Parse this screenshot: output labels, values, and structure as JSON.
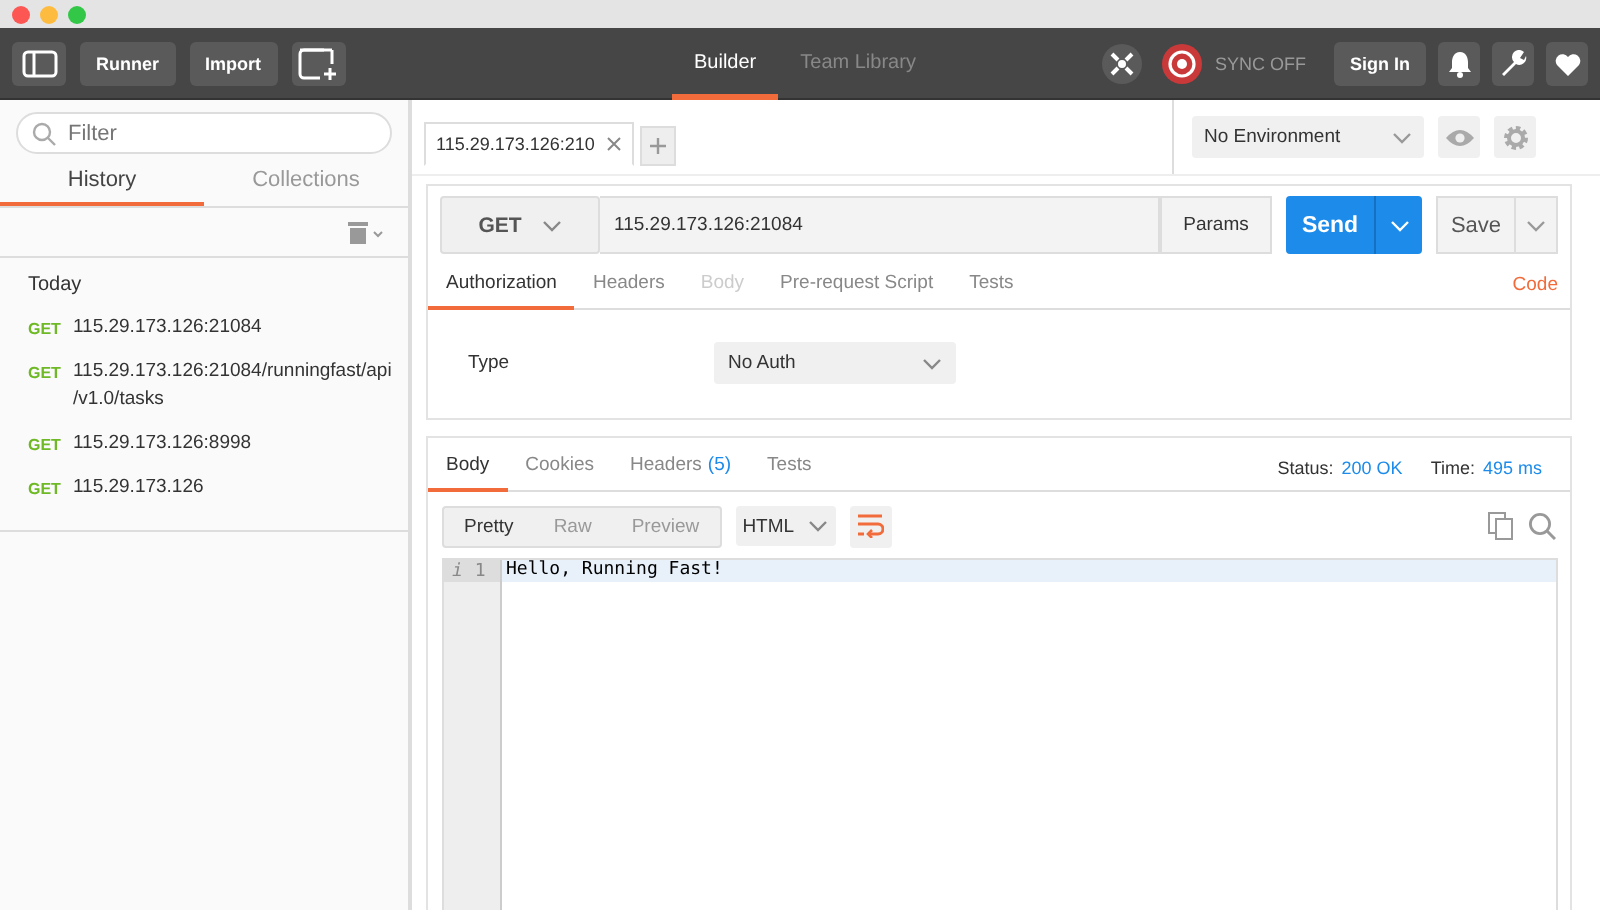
{
  "toolbar": {
    "buttons": [
      "Runner",
      "Import"
    ],
    "tabs": [
      {
        "label": "Builder",
        "selected": true
      },
      {
        "label": "Team Library",
        "selected": false
      }
    ],
    "sync": "SYNC OFF",
    "sign_in": "Sign In"
  },
  "sidebar": {
    "filter_placeholder": "Filter",
    "tabs": [
      {
        "label": "History",
        "selected": true
      },
      {
        "label": "Collections",
        "selected": false
      }
    ],
    "group": "Today",
    "history": [
      {
        "method": "GET",
        "url": "115.29.173.126:21084"
      },
      {
        "method": "GET",
        "url": "115.29.173.126:21084/runningfast/api/v1.0/tasks"
      },
      {
        "method": "GET",
        "url": "115.29.173.126:8998"
      },
      {
        "method": "GET",
        "url": "115.29.173.126"
      }
    ]
  },
  "request_tabs": [
    {
      "label": "115.29.173.126:210",
      "selected": true
    }
  ],
  "environment": "No Environment",
  "request": {
    "method": "GET",
    "url": "115.29.173.126:21084",
    "params": "Params",
    "send": "Send",
    "save": "Save",
    "tabs": [
      {
        "label": "Authorization",
        "selected": true,
        "disabled": false
      },
      {
        "label": "Headers",
        "selected": false,
        "disabled": false
      },
      {
        "label": "Body",
        "selected": false,
        "disabled": true
      },
      {
        "label": "Pre-request Script",
        "selected": false,
        "disabled": false
      },
      {
        "label": "Tests",
        "selected": false,
        "disabled": false
      }
    ],
    "code": "Code",
    "auth_label": "Type",
    "auth_type": "No Auth"
  },
  "response": {
    "tabs": [
      {
        "label": "Body",
        "selected": true
      },
      {
        "label": "Cookies",
        "selected": false
      },
      {
        "label": "Headers",
        "count": "(5)",
        "selected": false
      },
      {
        "label": "Tests",
        "selected": false
      }
    ],
    "status_label": "Status:",
    "status": "200 OK",
    "time_label": "Time:",
    "time": "495 ms",
    "views": [
      {
        "label": "Pretty",
        "selected": true
      },
      {
        "label": "Raw",
        "selected": false
      },
      {
        "label": "Preview",
        "selected": false
      }
    ],
    "format": "HTML",
    "lines": [
      {
        "marker": "i",
        "number": "1",
        "text": "Hello, Running Fast!"
      }
    ]
  }
}
